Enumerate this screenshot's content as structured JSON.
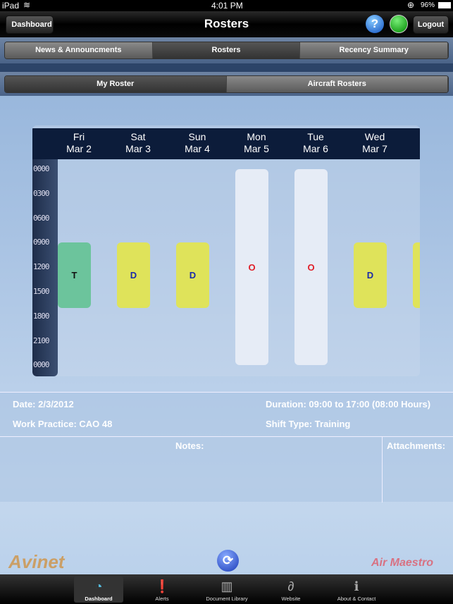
{
  "status": {
    "device": "iPad",
    "time": "4:01 PM",
    "battery": "96%"
  },
  "nav": {
    "back": "Dashboard",
    "title": "Rosters",
    "logout": "Logout"
  },
  "tabs": [
    "News & Announcments",
    "Rosters",
    "Recency Summary"
  ],
  "subtabs": [
    "My Roster",
    "Aircraft Rosters"
  ],
  "days": [
    {
      "d": "Fri",
      "date": "Mar 2"
    },
    {
      "d": "Sat",
      "date": "Mar 3"
    },
    {
      "d": "Sun",
      "date": "Mar 4"
    },
    {
      "d": "Mon",
      "date": "Mar 5"
    },
    {
      "d": "Tue",
      "date": "Mar 6"
    },
    {
      "d": "Wed",
      "date": "Mar 7"
    }
  ],
  "ticks": [
    "0000",
    "0300",
    "0600",
    "0900",
    "1200",
    "1500",
    "1800",
    "2100",
    "0000"
  ],
  "shifts": [
    {
      "day": 0,
      "code": "T",
      "start": 9,
      "end": 17,
      "color": "#6cc49c",
      "text": "#111"
    },
    {
      "day": 1,
      "code": "D",
      "start": 9,
      "end": 17,
      "color": "#dfe35a",
      "text": "#1a2aa8"
    },
    {
      "day": 2,
      "code": "D",
      "start": 9,
      "end": 17,
      "color": "#dfe35a",
      "text": "#1a2aa8"
    },
    {
      "day": 3,
      "code": "O",
      "start": 0,
      "end": 24,
      "color": "#e6ecf6",
      "text": "#e0202a"
    },
    {
      "day": 4,
      "code": "O",
      "start": 0,
      "end": 24,
      "color": "#e6ecf6",
      "text": "#e0202a"
    },
    {
      "day": 5,
      "code": "D",
      "start": 9,
      "end": 17,
      "color": "#dfe35a",
      "text": "#1a2aa8"
    },
    {
      "day": 6,
      "code": "",
      "start": 9,
      "end": 17,
      "color": "#dfe35a",
      "text": "#1a2aa8"
    }
  ],
  "details": {
    "date": "Date: 2/3/2012",
    "duration": "Duration: 09:00 to 17:00 (08:00 Hours)",
    "work_practice": "Work Practice: CAO 48",
    "shift_type": "Shift Type: Training",
    "notes": "Notes:",
    "attachments": "Attachments:"
  },
  "logos": {
    "left": "Avinet",
    "right": "Air Maestro"
  },
  "tabbar": [
    {
      "label": "Dashboard",
      "icon": "gauge-icon"
    },
    {
      "label": "Alerts",
      "icon": "alert-icon"
    },
    {
      "label": "Document Library",
      "icon": "book-icon"
    },
    {
      "label": "Website",
      "icon": "website-icon"
    },
    {
      "label": "About & Contact",
      "icon": "info-icon"
    }
  ]
}
